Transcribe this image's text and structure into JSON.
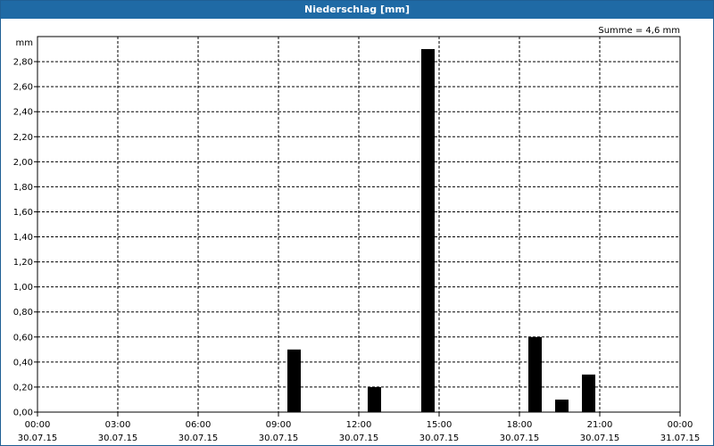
{
  "window": {
    "title": "Niederschlag [mm]"
  },
  "chart_data": {
    "type": "bar",
    "title": "Niederschlag [mm]",
    "ylabel": "mm",
    "annotation": "Summe = 4,6 mm",
    "ylim": [
      0,
      3.0
    ],
    "yticks": [
      0,
      0.2,
      0.4,
      0.6,
      0.8,
      1.0,
      1.2,
      1.4,
      1.6,
      1.8,
      2.0,
      2.2,
      2.4,
      2.6,
      2.8
    ],
    "ytick_labels": [
      "0,00",
      "0,20",
      "0,40",
      "0,60",
      "0,80",
      "1,00",
      "1,20",
      "1,40",
      "1,60",
      "1,80",
      "2,00",
      "2,20",
      "2,40",
      "2,60",
      "2,80"
    ],
    "xlim_hours": [
      0,
      24
    ],
    "xticks": [
      {
        "hour": 0,
        "time": "00:00",
        "date": "30.07.15"
      },
      {
        "hour": 3,
        "time": "03:00",
        "date": "30.07.15"
      },
      {
        "hour": 6,
        "time": "06:00",
        "date": "30.07.15"
      },
      {
        "hour": 9,
        "time": "09:00",
        "date": "30.07.15"
      },
      {
        "hour": 12,
        "time": "12:00",
        "date": "30.07.15"
      },
      {
        "hour": 15,
        "time": "15:00",
        "date": "30.07.15"
      },
      {
        "hour": 18,
        "time": "18:00",
        "date": "30.07.15"
      },
      {
        "hour": 21,
        "time": "21:00",
        "date": "30.07.15"
      },
      {
        "hour": 24,
        "time": "00:00",
        "date": "31.07.15"
      }
    ],
    "bars": [
      {
        "hour": 10,
        "value": 0.5
      },
      {
        "hour": 13,
        "value": 0.2
      },
      {
        "hour": 15,
        "value": 2.9
      },
      {
        "hour": 19,
        "value": 0.6
      },
      {
        "hour": 20,
        "value": 0.1
      },
      {
        "hour": 21,
        "value": 0.3
      }
    ],
    "grid": true,
    "colors": {
      "bar": "#000000",
      "grid": "#000000",
      "title_bar": "#1f6aa5"
    }
  }
}
